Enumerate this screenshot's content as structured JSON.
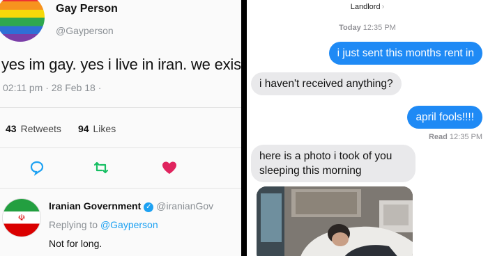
{
  "tweet": {
    "display_name": "Gay Person",
    "handle": "@Gayperson",
    "text": "yes im gay. yes i live in iran. we exist",
    "timestamp": "02:11 pm · 28 Feb 18 ·",
    "retweets_count": "43",
    "retweets_label": "Retweets",
    "likes_count": "94",
    "likes_label": "Likes",
    "icons": [
      "reply-icon",
      "retweet-icon",
      "like-heart-icon"
    ]
  },
  "reply": {
    "display_name": "Iranian Government",
    "handle": "@iranianGov",
    "replying_prefix": "Replying to",
    "replying_mention": "@Gayperson",
    "text": "Not for long."
  },
  "messages_app": {
    "contact": "Landlord",
    "day": "Today",
    "time": "12:35 PM",
    "messages": [
      {
        "from": "me",
        "text": "i just sent this months rent in"
      },
      {
        "from": "them",
        "text": "i haven't received anything?"
      },
      {
        "from": "me",
        "text": "april fools!!!!"
      },
      {
        "from": "them",
        "text": "here is a photo i took of you sleeping this morning"
      }
    ],
    "read_label": "Read",
    "read_time": "12:35 PM"
  },
  "colors": {
    "imessage_blue": "#1f8af5",
    "received_gray": "#e9e9eb",
    "twitter_blue": "#1da1f2",
    "like_red": "#e0245e",
    "retweet_green": "#17bf63"
  }
}
